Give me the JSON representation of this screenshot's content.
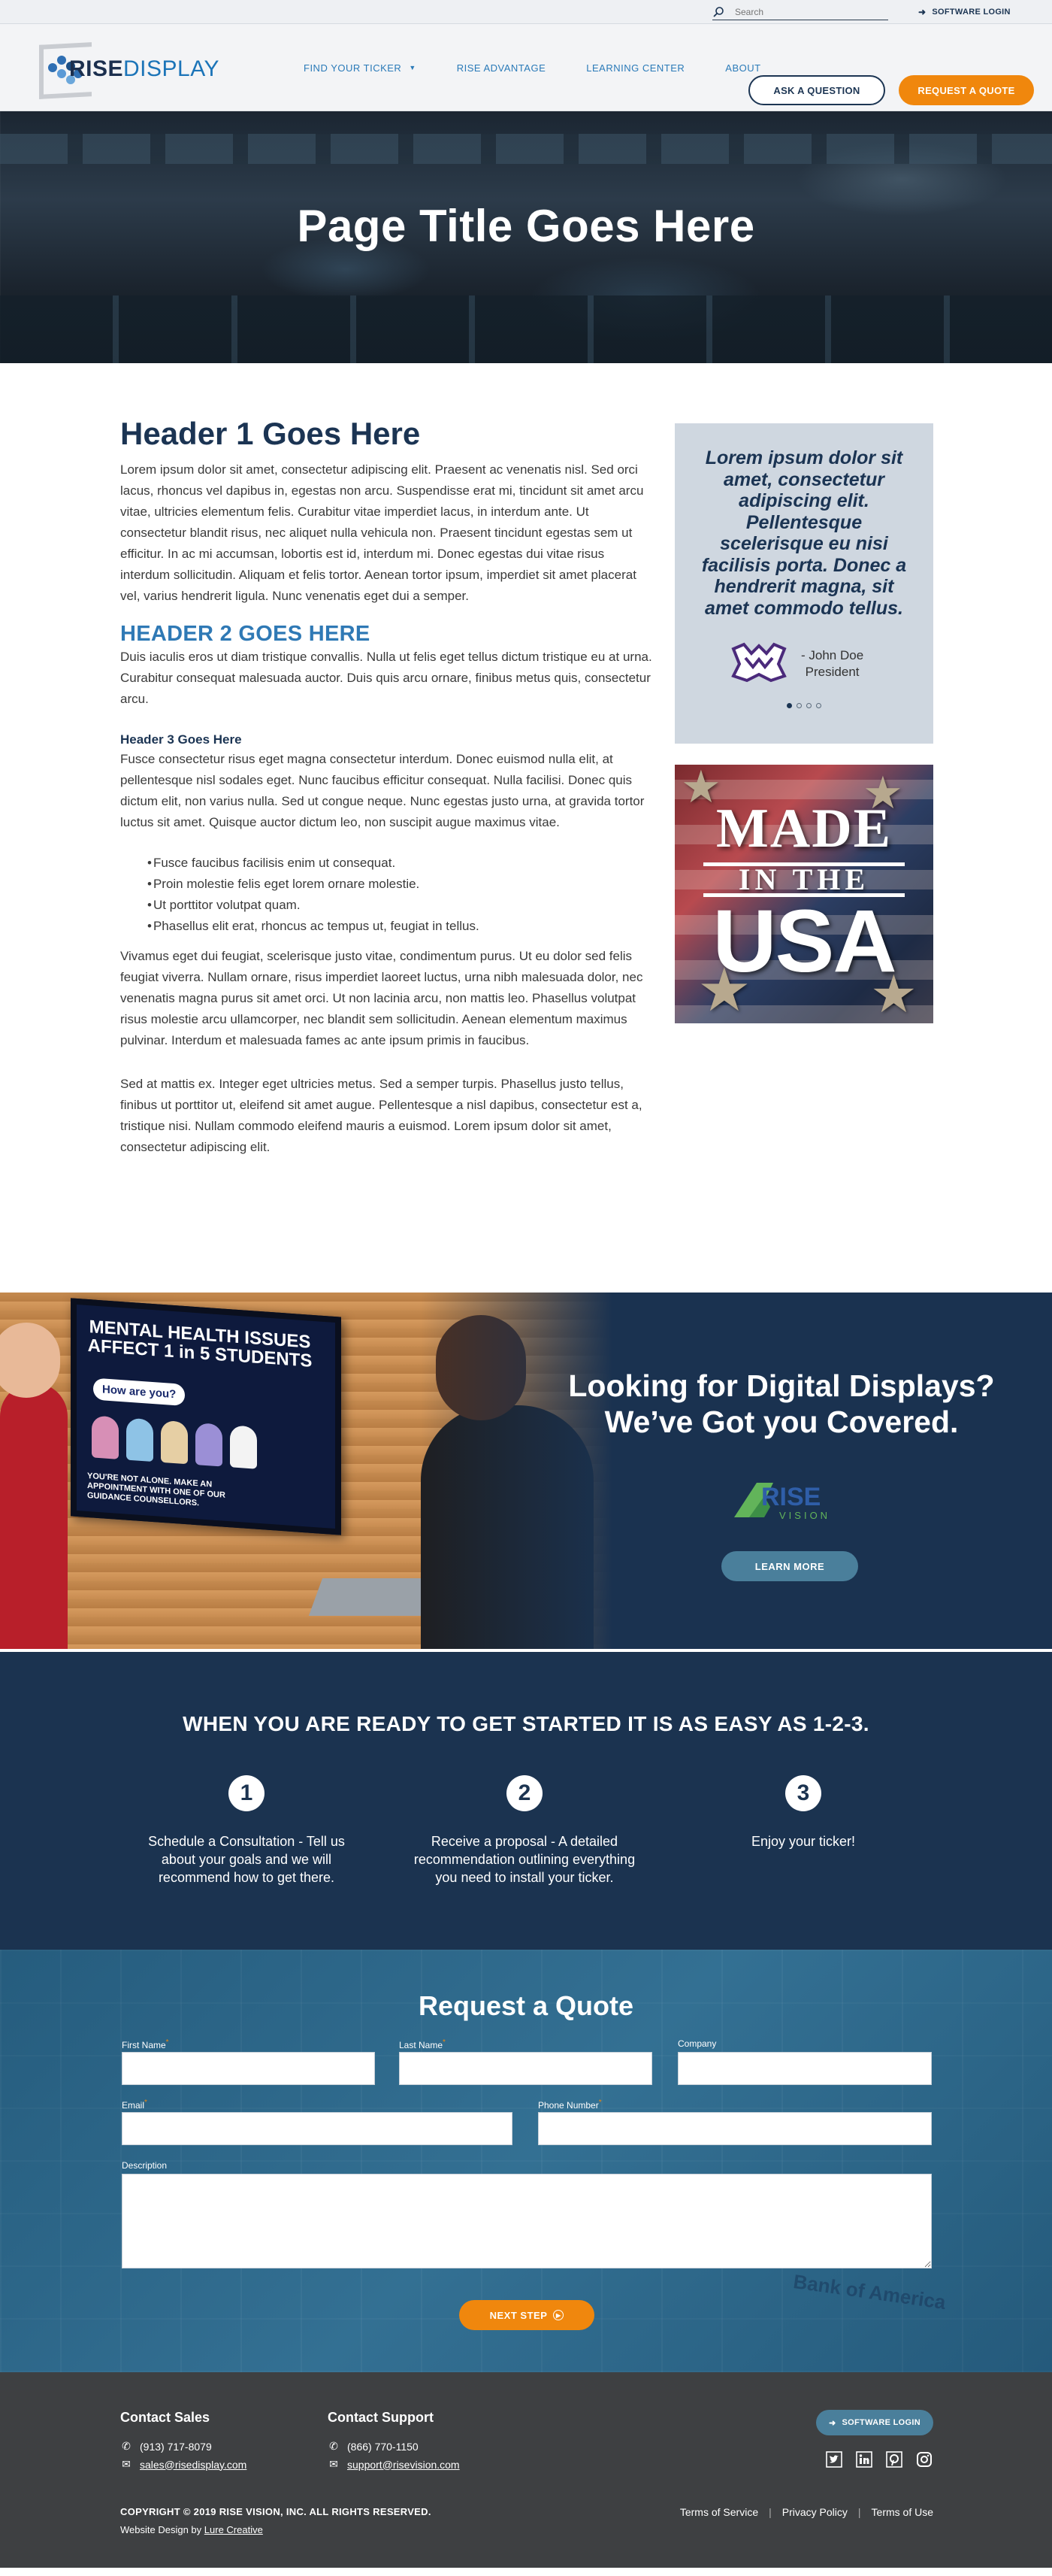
{
  "topbar": {
    "search_placeholder": "Search",
    "software_login": "SOFTWARE LOGIN"
  },
  "header": {
    "logo": {
      "rise": "RISE",
      "display": "DISPLAY"
    },
    "nav": [
      {
        "label": "FIND YOUR TICKER"
      },
      {
        "label": "RISE ADVANTAGE"
      },
      {
        "label": "LEARNING CENTER"
      },
      {
        "label": "ABOUT"
      }
    ],
    "ask_button": "ASK A QUESTION",
    "quote_button": "REQUEST A QUOTE"
  },
  "hero": {
    "title": "Page Title Goes Here"
  },
  "main": {
    "h1": "Header 1 Goes Here",
    "p1": "Lorem ipsum dolor sit amet, consectetur adipiscing elit. Praesent ac venenatis nisl. Sed orci lacus, rhoncus vel dapibus in, egestas non arcu. Suspendisse erat mi, tincidunt sit amet arcu vitae, ultricies elementum felis. Curabitur vitae imperdiet lacus, in interdum ante. Ut consectetur blandit risus, nec aliquet nulla vehicula non. Praesent tincidunt egestas sem ut efficitur. In ac mi accumsan, lobortis est id, interdum mi. Donec egestas dui vitae risus interdum sollicitudin. Aliquam et felis tortor. Aenean tortor ipsum, imperdiet sit amet placerat vel, varius hendrerit ligula. Nunc venenatis eget dui a semper.",
    "h2": "HEADER 2 GOES HERE",
    "p2": "Duis iaculis eros ut diam tristique convallis. Nulla ut felis eget tellus dictum tristique eu at urna. Curabitur consequat malesuada auctor. Duis quis arcu ornare, finibus metus quis, consectetur arcu.",
    "h3": "Header 3 Goes Here",
    "p3": "Fusce consectetur risus eget magna consectetur interdum. Donec euismod nulla elit, at pellentesque nisl sodales eget. Nunc faucibus efficitur consequat. Nulla facilisi. Donec quis dictum elit, non varius nulla. Sed ut congue neque. Nunc egestas justo urna, at gravida tortor luctus sit amet. Quisque auctor dictum leo, non suscipit augue maximus vitae.",
    "list": [
      "Fusce faucibus facilisis enim ut consequat.",
      "Proin molestie felis eget lorem ornare molestie.",
      "Ut porttitor volutpat quam.",
      "Phasellus elit erat, rhoncus ac tempus ut, feugiat in tellus."
    ],
    "p4": "Vivamus eget dui feugiat, scelerisque justo vitae, condimentum purus. Ut eu dolor sed felis feugiat viverra. Nullam ornare, risus imperdiet laoreet luctus, urna nibh malesuada dolor, nec venenatis magna purus sit amet orci. Ut non lacinia arcu, non mattis leo. Phasellus volutpat risus molestie arcu ullamcorper, nec blandit sem sollicitudin. Aenean elementum maximus pulvinar. Interdum et malesuada fames ac ante ipsum primis in faucibus.",
    "p5": "Sed at mattis ex. Integer eget ultricies metus. Sed a semper turpis. Phasellus justo tellus, finibus ut porttitor ut, eleifend sit amet augue. Pellentesque a nisl dapibus, consectetur est a, tristique nisi. Nullam commodo eleifend mauris a euismod. Lorem ipsum dolor sit amet, consectetur adipiscing elit."
  },
  "testimonial": {
    "quote": "Lorem ipsum dolor sit amet, consectetur adipiscing elit. Pellentesque scelerisque eu nisi facilisis porta. Donec a hendrerit magna, sit amet commodo tellus.",
    "author": "- John Doe",
    "role": "President",
    "slides": 4,
    "active_slide": 1
  },
  "made_in_usa": {
    "made": "MADE",
    "in_the": "IN THE",
    "usa": "USA"
  },
  "promo": {
    "tv_title": "MENTAL HEALTH ISSUES AFFECT 1 in 5 STUDENTS",
    "tv_bubble": "How are you?",
    "tv_footer": "YOU'RE NOT ALONE. MAKE AN APPOINTMENT WITH ONE OF OUR GUIDANCE COUNSELLORS.",
    "title": "Looking for Digital Displays? We’ve Got you Covered.",
    "logo_rise": "RISE",
    "logo_vision": "VISION",
    "learn_more": "LEARN MORE"
  },
  "steps": {
    "title": "WHEN YOU ARE READY TO GET STARTED IT IS AS EASY AS 1-2-3.",
    "items": [
      {
        "num": "1",
        "text": "Schedule a Consultation - Tell us about your goals and we will recommend how to get there."
      },
      {
        "num": "2",
        "text": "Receive a proposal - A detailed recommendation outlining everything you need to install your ticker."
      },
      {
        "num": "3",
        "text": "Enjoy your ticker!"
      }
    ]
  },
  "quote_form": {
    "title": "Request a Quote",
    "first_name": "First Name",
    "last_name": "Last Name",
    "company": "Company",
    "email": "Email",
    "phone": "Phone Number",
    "description": "Description",
    "required_mark": "*",
    "next_step": "NEXT STEP",
    "bg_sign": "Bank of America"
  },
  "footer": {
    "sales_title": "Contact Sales",
    "sales_phone": "(913) 717-8079",
    "sales_email": "sales@risedisplay.com",
    "support_title": "Contact Support",
    "support_phone": "(866) 770-1150",
    "support_email": "support@risevision.com",
    "software_login": "SOFTWARE LOGIN",
    "copyright": "COPYRIGHT © 2019 RISE VISION, INC. ALL RIGHTS RESERVED.",
    "design_prefix": "Website Design by",
    "design_link": "Lure Creative",
    "links": [
      "Terms of Service",
      "Privacy Policy",
      "Terms of Use"
    ]
  },
  "colors": {
    "navy": "#1b3453",
    "accent_blue": "#2f79b5",
    "orange": "#f0870d",
    "teal_button": "#4a7f9b",
    "footer_bg": "#3e4042",
    "quote_bg": "#cfd7e0"
  }
}
